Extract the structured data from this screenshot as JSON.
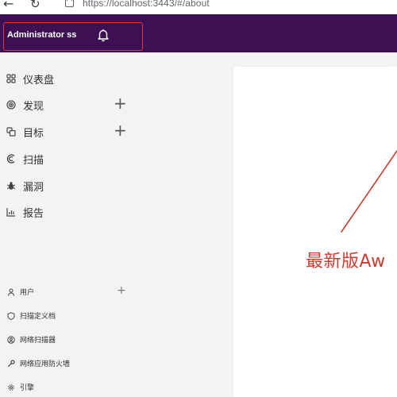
{
  "browser": {
    "url": "https://localhost:3443/#/about",
    "back_icon": "arrow-left-icon",
    "reload_icon": "reload-icon",
    "lock_icon": "lock-icon"
  },
  "header": {
    "user": "Administrator ss",
    "bell_icon": "bell-icon",
    "background": "#3c1052"
  },
  "sidebar": {
    "items": [
      {
        "label": "仪表盘",
        "icon": "dashboard-icon"
      },
      {
        "label": "发现",
        "icon": "target-icon",
        "expandable": true
      },
      {
        "label": "目标",
        "icon": "copy-icon",
        "expandable": true
      },
      {
        "label": "扫描",
        "icon": "scan-icon"
      },
      {
        "label": "漏洞",
        "icon": "bug-icon"
      },
      {
        "label": "报告",
        "icon": "bar-chart-icon"
      }
    ],
    "bottom_items": [
      {
        "label": "用户",
        "icon": "user-icon",
        "expandable": true
      },
      {
        "label": "扫描定义档",
        "icon": "shield-icon"
      },
      {
        "label": "网络扫描器",
        "icon": "network-icon"
      },
      {
        "label": "网络应用防火墙",
        "icon": "wrench-icon"
      },
      {
        "label": "引擎",
        "icon": "gear-icon"
      }
    ]
  },
  "annotation": {
    "text": "最新版Aw",
    "color": "#d03a2f"
  }
}
